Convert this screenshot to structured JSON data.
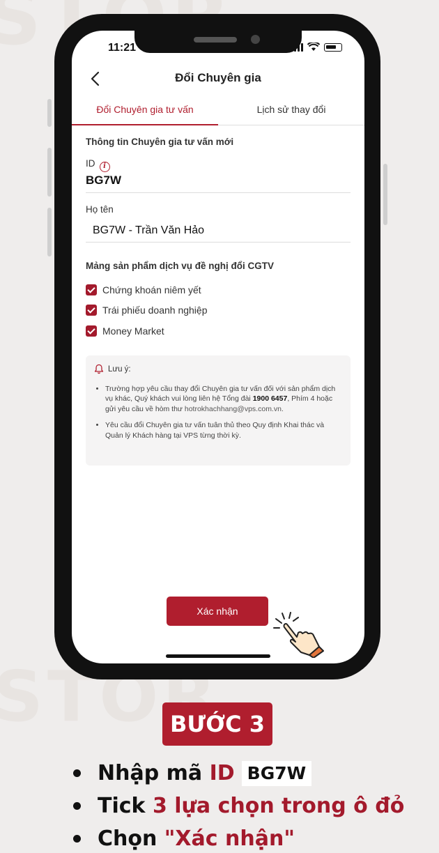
{
  "status_bar": {
    "time": "11:21"
  },
  "header": {
    "title": "Đổi Chuyên gia"
  },
  "tabs": [
    {
      "label": "Đổi Chuyên gia tư vấn",
      "active": true
    },
    {
      "label": "Lịch sử thay đổi",
      "active": false
    }
  ],
  "form": {
    "section_title": "Thông tin Chuyên gia tư vấn mới",
    "id_label": "ID",
    "id_value": "BG7W",
    "name_label": "Họ tên",
    "name_value": "BG7W - Trần Văn Hảo",
    "products_title": "Mảng sản phẩm dịch vụ đề nghị đổi CGTV",
    "products": [
      {
        "label": "Chứng khoán niêm yết",
        "checked": true
      },
      {
        "label": "Trái phiếu doanh nghiệp",
        "checked": true
      },
      {
        "label": "Money Market",
        "checked": true
      }
    ]
  },
  "note": {
    "title": "Lưu ý:",
    "item1_text": "Trường hợp yêu cầu thay đổi Chuyên gia tư vấn đối với sản phẩm dịch vụ khác, Quý khách vui lòng liên hệ Tổng đài ",
    "item1_phone": "1900 6457",
    "item1_suffix": ", Phím 4 hoặc gửi yêu cầu về hòm thư ",
    "item1_email": "hotrokhachhang@vps.com.vn.",
    "item2_text": "Yêu cầu đổi Chuyên gia tư vấn tuân thủ theo Quy định Khai thác và Quản lý Khách hàng tại VPS từng thời kỳ."
  },
  "confirm_button": "Xác nhận",
  "watermark": "STOR",
  "instructions": {
    "step_label": "BƯỚC 3",
    "line1_prefix": "Nhập mã",
    "line1_highlight": "ID",
    "line1_value": "BG7W",
    "line2_prefix": "Tick",
    "line2_highlight": "3 lựa chọn trong ô đỏ",
    "line3_prefix": "Chọn",
    "line3_highlight": "\"Xác nhận\""
  },
  "colors": {
    "accent": "#b01e2e",
    "background": "#efedec"
  }
}
